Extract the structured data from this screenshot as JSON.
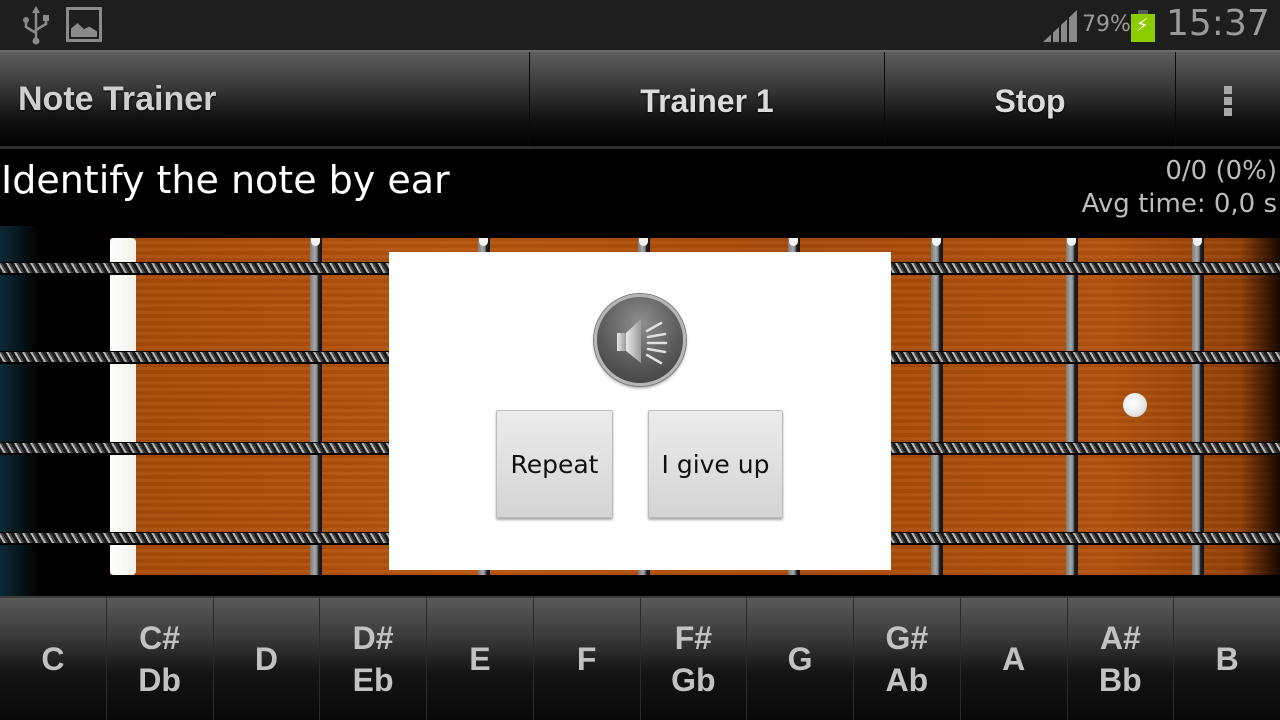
{
  "status_bar": {
    "left_icons": [
      "usb-icon",
      "image-notification-icon"
    ],
    "signal_icon": "signal-strength-icon",
    "battery_percent": "79%",
    "battery_icon": "battery-charging-icon",
    "battery_color": "#8ccc00",
    "clock": "15:37"
  },
  "action_bar": {
    "title": "Note Trainer",
    "trainer_label": "Trainer 1",
    "stop_label": "Stop",
    "overflow_icon": "overflow-menu-icon"
  },
  "exercise": {
    "instruction": "Identify the note by ear",
    "score": "0/0 (0%)",
    "avg_time": "Avg time: 0,0 s"
  },
  "fretboard": {
    "strings": 4,
    "frets_visible": 7,
    "inlay_marker": "dot"
  },
  "dialog": {
    "play_icon": "speaker-icon",
    "repeat_label": "Repeat",
    "give_up_label": "I give up"
  },
  "note_keys": [
    {
      "top": "C",
      "bottom": ""
    },
    {
      "top": "C#",
      "bottom": "Db"
    },
    {
      "top": "D",
      "bottom": ""
    },
    {
      "top": "D#",
      "bottom": "Eb"
    },
    {
      "top": "E",
      "bottom": ""
    },
    {
      "top": "F",
      "bottom": ""
    },
    {
      "top": "F#",
      "bottom": "Gb"
    },
    {
      "top": "G",
      "bottom": ""
    },
    {
      "top": "G#",
      "bottom": "Ab"
    },
    {
      "top": "A",
      "bottom": ""
    },
    {
      "top": "A#",
      "bottom": "Bb"
    },
    {
      "top": "B",
      "bottom": ""
    }
  ]
}
